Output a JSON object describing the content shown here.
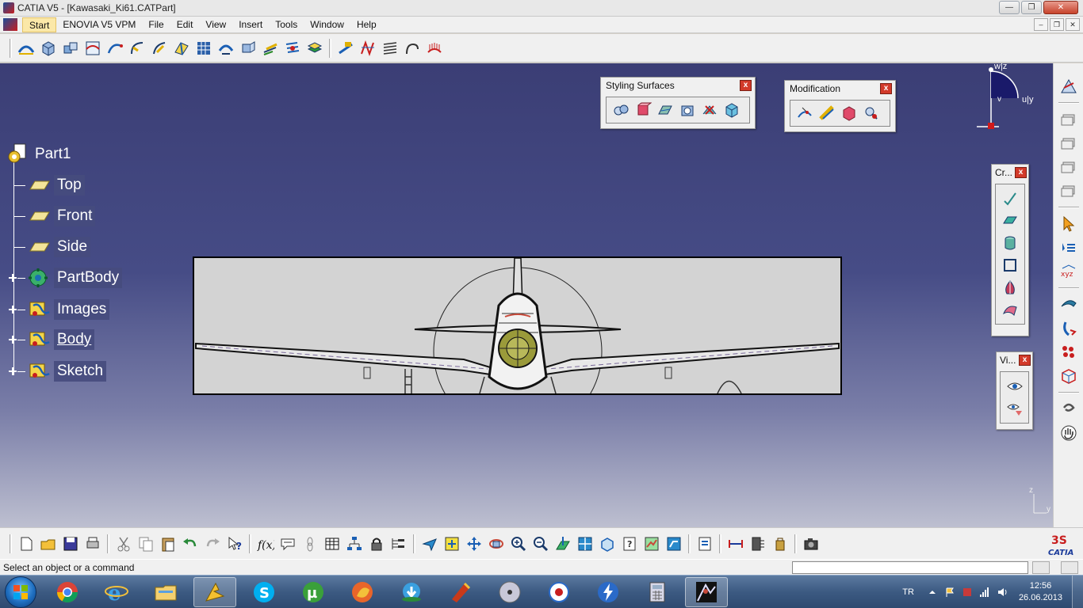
{
  "window": {
    "title": "CATIA V5 - [Kawasaki_Ki61.CATPart]",
    "minimize_glyph": "—",
    "maximize_glyph": "❐",
    "close_glyph": "✕"
  },
  "menubar": {
    "items": [
      "Start",
      "ENOVIA V5 VPM",
      "File",
      "Edit",
      "View",
      "Insert",
      "Tools",
      "Window",
      "Help"
    ],
    "mdi_minimize": "–",
    "mdi_restore": "❐",
    "mdi_close": "✕"
  },
  "tree": {
    "root": "Part1",
    "nodes": [
      {
        "label": "Top",
        "icon": "plane-icon",
        "expandable": false
      },
      {
        "label": "Front",
        "icon": "plane-icon",
        "expandable": false
      },
      {
        "label": "Side",
        "icon": "plane-icon",
        "expandable": false
      },
      {
        "label": "PartBody",
        "icon": "partbody-gear-icon",
        "expandable": true
      },
      {
        "label": "Images",
        "icon": "geometrical-set-icon",
        "expandable": true
      },
      {
        "label": "Body",
        "icon": "geometrical-set-icon",
        "expandable": true
      },
      {
        "label": "Sketch",
        "icon": "geometrical-set-icon",
        "expandable": true
      }
    ]
  },
  "floating_toolbars": {
    "styling": {
      "title": "Styling Surfaces",
      "close": "x"
    },
    "modification": {
      "title": "Modification",
      "close": "x"
    },
    "create": {
      "title": "Cr...",
      "close": "x"
    },
    "view": {
      "title": "Vi...",
      "close": "x"
    }
  },
  "compass": {
    "label_z": "w|z",
    "label_u": "u|y",
    "label_v": "v"
  },
  "axis_triad": {
    "z": "z",
    "y": "y"
  },
  "status": {
    "message": "Select an object or a command",
    "command_placeholder": ""
  },
  "taskbar": {
    "apps": [
      "internet-explorer-icon",
      "chrome-icon",
      "explorer-folder-icon",
      "catia-launch-icon",
      "skype-icon",
      "utorrent-icon",
      "firefox-icon",
      "internet-download-manager-icon",
      "ccleaner-icon",
      "media-disc-icon",
      "media-player-icon",
      "lightning-icon",
      "calculator-icon",
      "catia-active-icon"
    ],
    "language": "TR",
    "time": "12:56",
    "date": "26.06.2013"
  },
  "colors": {
    "viewport_top": "#3b3e75",
    "viewport_bottom": "#bdbfd0",
    "close_red": "#d23a2a",
    "taskbar": "#3c5a82"
  }
}
